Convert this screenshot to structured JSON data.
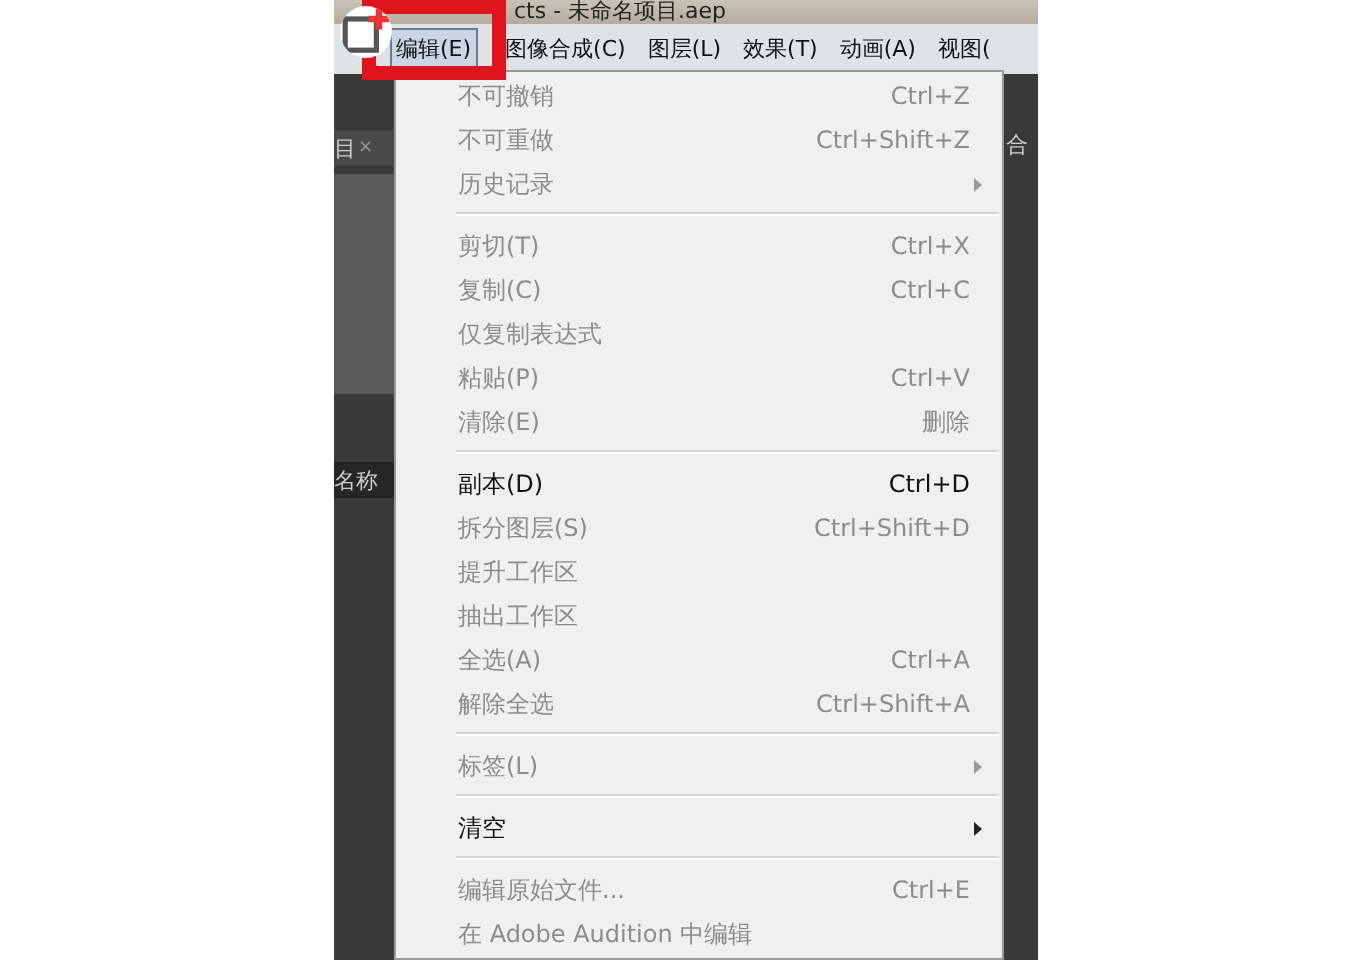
{
  "window": {
    "title": "cts - 未命名项目.aep"
  },
  "menu_bar": [
    {
      "label": "编辑(E)",
      "selected": true
    },
    {
      "label": "图像合成(C)",
      "selected": false
    },
    {
      "label": "图层(L)",
      "selected": false
    },
    {
      "label": "效果(T)",
      "selected": false
    },
    {
      "label": "动画(A)",
      "selected": false
    },
    {
      "label": "视图(",
      "selected": false
    }
  ],
  "left_panel": {
    "tab": "目",
    "close": "×",
    "column": "名称"
  },
  "right_panel": {
    "tab": "合"
  },
  "menu_groups": [
    [
      {
        "label": "不可撤销",
        "shortcut": "Ctrl+Z",
        "disabled": true,
        "submenu": false
      },
      {
        "label": "不可重做",
        "shortcut": "Ctrl+Shift+Z",
        "disabled": true,
        "submenu": false
      },
      {
        "label": "历史记录",
        "disabled": true,
        "submenu": true
      }
    ],
    [
      {
        "label": "剪切(T)",
        "shortcut": "Ctrl+X",
        "disabled": true,
        "submenu": false
      },
      {
        "label": "复制(C)",
        "shortcut": "Ctrl+C",
        "disabled": true,
        "submenu": false
      },
      {
        "label": "仅复制表达式",
        "disabled": true,
        "submenu": false
      },
      {
        "label": "粘贴(P)",
        "shortcut": "Ctrl+V",
        "disabled": true,
        "submenu": false
      },
      {
        "label": "清除(E)",
        "shortcut": "删除",
        "disabled": true,
        "submenu": false
      }
    ],
    [
      {
        "label": "副本(D)",
        "shortcut": "Ctrl+D",
        "disabled": false,
        "submenu": false
      },
      {
        "label": "拆分图层(S)",
        "shortcut": "Ctrl+Shift+D",
        "disabled": true,
        "submenu": false
      },
      {
        "label": "提升工作区",
        "disabled": true,
        "submenu": false
      },
      {
        "label": "抽出工作区",
        "disabled": true,
        "submenu": false
      },
      {
        "label": "全选(A)",
        "shortcut": "Ctrl+A",
        "disabled": true,
        "submenu": false
      },
      {
        "label": "解除全选",
        "shortcut": "Ctrl+Shift+A",
        "disabled": true,
        "submenu": false
      }
    ],
    [
      {
        "label": "标签(L)",
        "disabled": true,
        "submenu": true
      }
    ],
    [
      {
        "label": "清空",
        "disabled": false,
        "submenu": true
      }
    ],
    [
      {
        "label": "编辑原始文件...",
        "shortcut": "Ctrl+E",
        "disabled": true,
        "submenu": false
      },
      {
        "label": "在 Adobe Audition 中编辑",
        "disabled": true,
        "submenu": false
      }
    ]
  ]
}
